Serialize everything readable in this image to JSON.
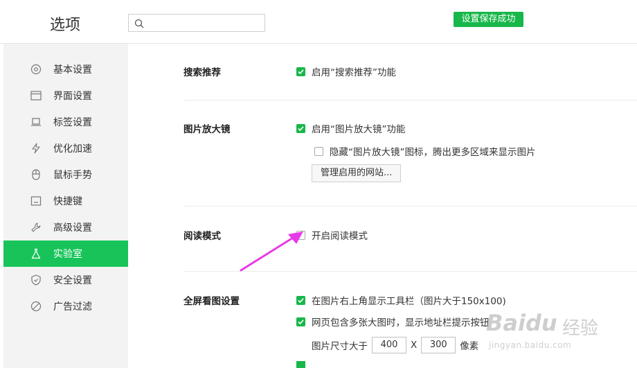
{
  "header": {
    "title": "选项",
    "search_placeholder": "",
    "toast": "设置保存成功"
  },
  "sidebar": {
    "items": [
      {
        "label": "基本设置",
        "icon": "gear-icon",
        "active": false
      },
      {
        "label": "界面设置",
        "icon": "window-icon",
        "active": false
      },
      {
        "label": "标签设置",
        "icon": "tab-icon",
        "active": false
      },
      {
        "label": "优化加速",
        "icon": "lightning-icon",
        "active": false
      },
      {
        "label": "鼠标手势",
        "icon": "mouse-icon",
        "active": false
      },
      {
        "label": "快捷键",
        "icon": "keyboard-icon",
        "active": false
      },
      {
        "label": "高级设置",
        "icon": "wrench-icon",
        "active": false
      },
      {
        "label": "实验室",
        "icon": "flask-icon",
        "active": true
      },
      {
        "label": "安全设置",
        "icon": "shield-icon",
        "active": false
      },
      {
        "label": "广告过滤",
        "icon": "ban-icon",
        "active": false
      }
    ]
  },
  "sections": {
    "search_rec": {
      "title": "搜索推荐",
      "option": {
        "label": "启用“搜索推荐”功能",
        "checked": true
      }
    },
    "magnifier": {
      "title": "图片放大镜",
      "option1": {
        "label": "启用“图片放大镜”功能",
        "checked": true
      },
      "option2": {
        "label": "隐藏“图片放大镜”图标，腾出更多区域来显示图片",
        "checked": false
      },
      "button": "管理启用的网站..."
    },
    "reading": {
      "title": "阅读模式",
      "option": {
        "label": "开启阅读模式",
        "checked": false
      }
    },
    "fullscreen": {
      "title": "全屏看图设置",
      "option1": {
        "label": "在图片右上角显示工具栏（图片大于150x100)",
        "checked": true
      },
      "option2": {
        "label": "网页包含多张大图时，显示地址栏提示按钮",
        "checked": true
      },
      "size_label": "图片尺寸大于",
      "width": "400",
      "x_sep": "X",
      "height": "300",
      "unit": "像素"
    }
  },
  "colors": {
    "accent": "#18c45a",
    "arrow": "#e83ae8"
  },
  "watermark": {
    "brand": "Baidu",
    "sub": "经验",
    "url": "jingyan.baidu.com"
  }
}
